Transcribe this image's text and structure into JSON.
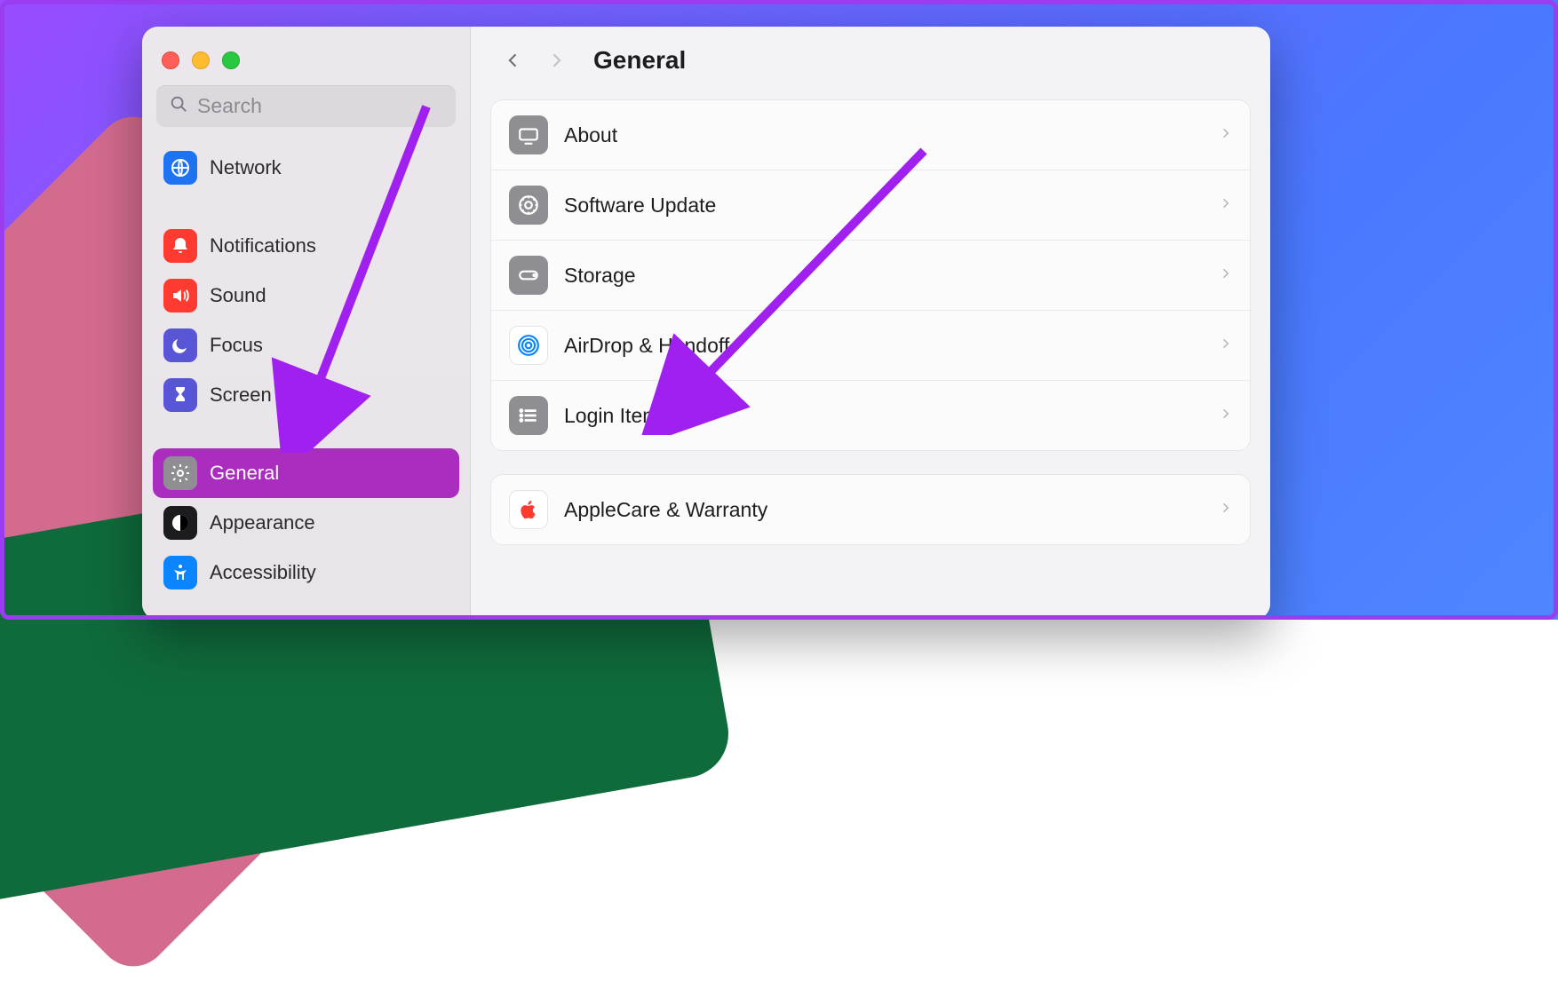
{
  "search": {
    "placeholder": "Search"
  },
  "sidebar": {
    "items": [
      {
        "label": "Network"
      },
      {
        "label": "Notifications"
      },
      {
        "label": "Sound"
      },
      {
        "label": "Focus"
      },
      {
        "label": "Screen Time"
      },
      {
        "label": "General"
      },
      {
        "label": "Appearance"
      },
      {
        "label": "Accessibility"
      }
    ]
  },
  "header": {
    "title": "General"
  },
  "content": {
    "group1": {
      "about": "About",
      "software_update": "Software Update",
      "storage": "Storage",
      "airdrop": "AirDrop & Handoff",
      "login_items": "Login Items"
    },
    "group2": {
      "applecare": "AppleCare & Warranty"
    }
  },
  "colors": {
    "selected_sidebar": "#aa2dbf",
    "arrow": "#a020f0"
  }
}
